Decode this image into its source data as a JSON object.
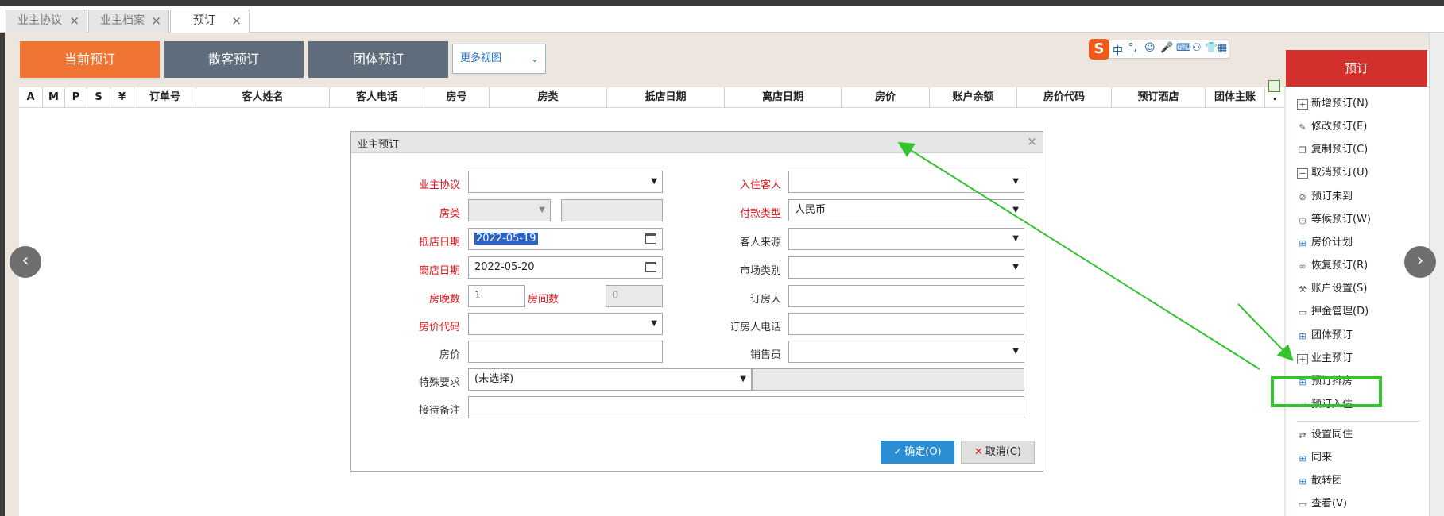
{
  "tabs": [
    {
      "label": "业主协议",
      "close": "×"
    },
    {
      "label": "业主档案",
      "close": "×"
    },
    {
      "label": "预订",
      "close": "×"
    }
  ],
  "toolbar": {
    "current": "当前预订",
    "walkin": "散客预订",
    "group": "团体预订",
    "view_select": "更多视图",
    "view_chevron": "⌄"
  },
  "ime": {
    "logo": "S",
    "items": [
      "中",
      "°,",
      "☺",
      "🎤",
      "⌨",
      "⚇",
      "👕",
      "▦"
    ]
  },
  "columns": [
    "A",
    "M",
    "P",
    "S",
    "¥",
    "订单号",
    "客人姓名",
    "客人电话",
    "房号",
    "房类",
    "抵店日期",
    "离店日期",
    "房价",
    "账户余额",
    "房价代码",
    "预订酒店",
    "团体主账",
    "."
  ],
  "nav": {
    "prev": "‹",
    "next": "›"
  },
  "dialog": {
    "title": "业主预订",
    "close": "×",
    "left_fields": {
      "agreement": {
        "label": "业主协议",
        "value": ""
      },
      "room_type": {
        "label": "房类",
        "value": ""
      },
      "arrival": {
        "label": "抵店日期",
        "value": "2022-05-19"
      },
      "departure": {
        "label": "离店日期",
        "value": "2022-05-20"
      },
      "nights": {
        "label": "房晚数",
        "value": "1"
      },
      "rooms": {
        "label": "房间数",
        "value": "0"
      },
      "rate_code": {
        "label": "房价代码",
        "value": ""
      },
      "rate": {
        "label": "房价",
        "value": ""
      }
    },
    "right_fields": {
      "guest": {
        "label": "入住客人",
        "value": ""
      },
      "payment": {
        "label": "付款类型",
        "value": "人民币"
      },
      "source": {
        "label": "客人来源",
        "value": ""
      },
      "market": {
        "label": "市场类别",
        "value": ""
      },
      "booker": {
        "label": "订房人",
        "value": ""
      },
      "booker_phone": {
        "label": "订房人电话",
        "value": ""
      },
      "sales": {
        "label": "销售员",
        "value": ""
      }
    },
    "special": {
      "label": "特殊要求",
      "value": "(未选择)"
    },
    "remarks": {
      "label": "接待备注",
      "value": ""
    },
    "ok": "确定(O)",
    "cancel": "取消(C)"
  },
  "sidebar": {
    "title": "预订",
    "items": [
      {
        "label": "新增预订(N)",
        "icon": "plus-box-icon"
      },
      {
        "label": "修改预订(E)",
        "icon": "edit-icon"
      },
      {
        "label": "复制预订(C)",
        "icon": "copy-icon"
      },
      {
        "label": "取消预订(U)",
        "icon": "minus-box-icon"
      },
      {
        "label": "预订未到",
        "icon": "ban-icon"
      },
      {
        "label": "等候预订(W)",
        "icon": "clock-icon"
      },
      {
        "label": "房价计划",
        "icon": "grid-icon"
      },
      {
        "label": "恢复预订(R)",
        "icon": "restore-icon"
      },
      {
        "label": "账户设置(S)",
        "icon": "wrench-icon"
      },
      {
        "label": "押金管理(D)",
        "icon": "deposit-icon"
      },
      {
        "label": "团体预订",
        "icon": "grid-icon"
      },
      {
        "label": "业主预订",
        "icon": "plus-box-icon"
      },
      {
        "label": "预订排房",
        "icon": "grid-icon"
      },
      {
        "label": "预订入住",
        "icon": "checkin-icon"
      },
      {
        "label": "设置同住",
        "icon": "share-icon"
      },
      {
        "label": "同来",
        "icon": "grid-icon"
      },
      {
        "label": "散转团",
        "icon": "grid-icon"
      },
      {
        "label": "查看(V)",
        "icon": "monitor-icon"
      }
    ]
  },
  "colors": {
    "accent_orange": "#ef7331",
    "slate": "#5f6c7b",
    "red": "#d2302d",
    "highlight": "#34c22e",
    "ok_blue": "#2b8ed4"
  }
}
